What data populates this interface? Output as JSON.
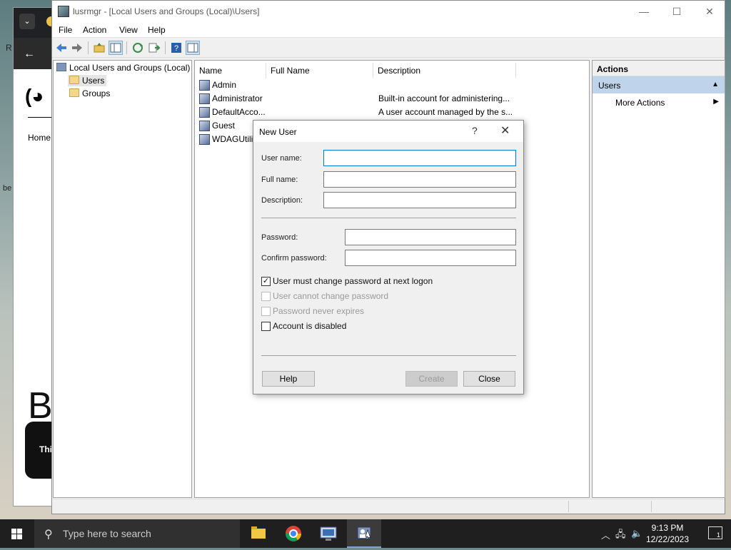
{
  "window": {
    "title": "lusrmgr - [Local Users and Groups (Local)\\Users]",
    "minimize": "—",
    "maximize": "☐",
    "close": "✕"
  },
  "menu": [
    "File",
    "Action",
    "View",
    "Help"
  ],
  "tree": {
    "root": "Local Users and Groups (Local)",
    "items": [
      "Users",
      "Groups"
    ]
  },
  "list": {
    "columns": [
      "Name",
      "Full Name",
      "Description"
    ],
    "rows": [
      {
        "name": "Admin",
        "description": ""
      },
      {
        "name": "Administrator",
        "description": "Built-in account for administering..."
      },
      {
        "name": "DefaultAcco...",
        "description": "A user account managed by the s..."
      },
      {
        "name": "Guest",
        "description": ""
      },
      {
        "name": "WDAGUtilit",
        "description": ""
      }
    ]
  },
  "actions": {
    "header": "Actions",
    "section": "Users",
    "more": "More Actions"
  },
  "dialog": {
    "title": "New User",
    "help_glyph": "?",
    "close_glyph": "✕",
    "username_label": "User name:",
    "fullname_label": "Full name:",
    "description_label": "Description:",
    "password_label": "Password:",
    "confirm_label": "Confirm password:",
    "username_value": "",
    "fullname_value": "",
    "description_value": "",
    "password_value": "",
    "confirm_value": "",
    "checkboxes": [
      {
        "label": "User must change password at next logon",
        "checked": true,
        "enabled": true
      },
      {
        "label": "User cannot change password",
        "checked": false,
        "enabled": false
      },
      {
        "label": "Password never expires",
        "checked": false,
        "enabled": false
      },
      {
        "label": "Account is disabled",
        "checked": false,
        "enabled": true
      }
    ],
    "help_button": "Help",
    "create_button": "Create",
    "close_button": "Close"
  },
  "browser": {
    "home_link": "Home",
    "big_letter": "B",
    "card_text": "Thi",
    "logo": "(◕"
  },
  "desktop_text": {
    "r": "R",
    "be": "be"
  },
  "taskbar": {
    "search_placeholder": "Type here to search",
    "time": "9:13 PM",
    "date": "12/22/2023",
    "notifications": "1"
  }
}
